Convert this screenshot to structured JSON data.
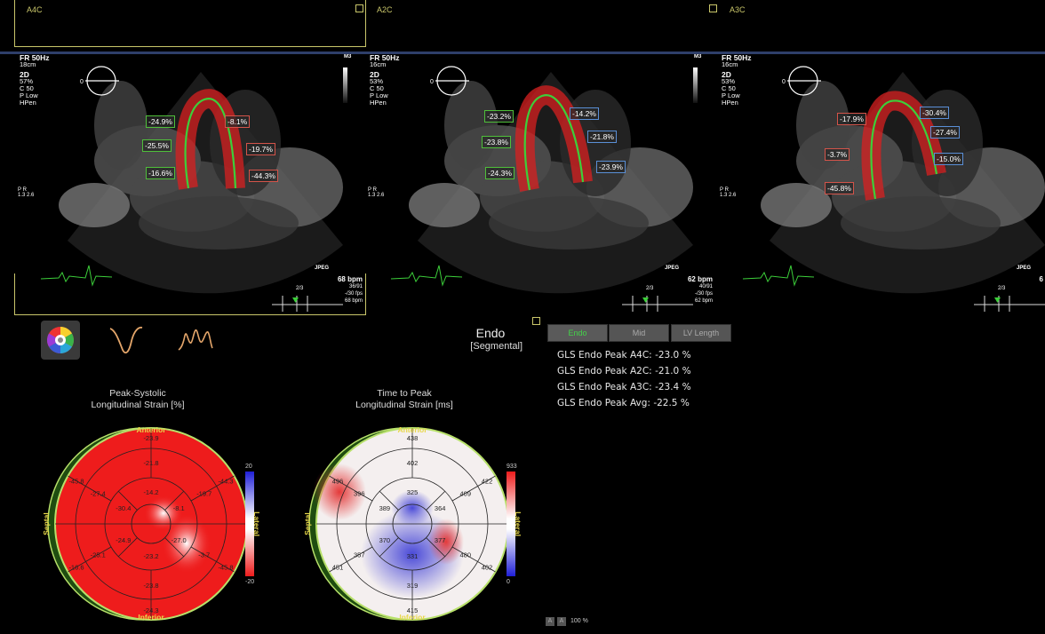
{
  "views": [
    {
      "title": "A4C",
      "fr": "FR 50Hz",
      "depth": "18cm",
      "mode": "2D",
      "params": [
        "57%",
        "C 50",
        "P Low",
        "HPen"
      ],
      "bpm": "68 bpm",
      "frames": "36/91",
      "fps": "-/30 fps",
      "bpm2": "68 bpm",
      "cycle": "2/3",
      "segments": [
        {
          "label": "-24.9%",
          "c": "g"
        },
        {
          "label": "-25.5%",
          "c": "g"
        },
        {
          "label": "-16.6%",
          "c": "g"
        },
        {
          "label": "-8.1%",
          "c": "r"
        },
        {
          "label": "-19.7%",
          "c": "r"
        },
        {
          "label": "-44.3%",
          "c": "r"
        }
      ]
    },
    {
      "title": "A2C",
      "fr": "FR 50Hz",
      "depth": "16cm",
      "mode": "2D",
      "params": [
        "53%",
        "C 50",
        "P Low",
        "HPen"
      ],
      "bpm": "62 bpm",
      "frames": "40/91",
      "fps": "-/30 fps",
      "bpm2": "62 bpm",
      "cycle": "2/3",
      "segments": [
        {
          "label": "-23.2%",
          "c": "g"
        },
        {
          "label": "-23.8%",
          "c": "g"
        },
        {
          "label": "-24.3%",
          "c": "g"
        },
        {
          "label": "-14.2%",
          "c": "b"
        },
        {
          "label": "-21.8%",
          "c": "b"
        },
        {
          "label": "-23.9%",
          "c": "b"
        }
      ]
    },
    {
      "title": "A3C",
      "fr": "FR 50Hz",
      "depth": "16cm",
      "mode": "2D",
      "params": [
        "53%",
        "C 50",
        "P Low",
        "HPen"
      ],
      "bpm": "6",
      "frames": "",
      "fps": "",
      "bpm2": "",
      "cycle": "2/3",
      "segments": [
        {
          "label": "-17.9%",
          "c": "r"
        },
        {
          "label": "-3.7%",
          "c": "r"
        },
        {
          "label": "-45.8%",
          "c": "r"
        },
        {
          "label": "-30.4%",
          "c": "b"
        },
        {
          "label": "-27.4%",
          "c": "b"
        },
        {
          "label": "-15.0%",
          "c": "b"
        }
      ]
    }
  ],
  "m3_label": "M3",
  "jpeg_label": "JPEG",
  "probe": {
    "p": "P",
    "r": "R",
    "zero": "0",
    "left": "1.3",
    "right": "2.6"
  },
  "mode_center": {
    "title": "Endo",
    "subtitle": "[Segmental]"
  },
  "tabs": [
    {
      "label": "Endo",
      "active": true
    },
    {
      "label": "Mid",
      "active": false
    },
    {
      "label": "LV Length",
      "active": false
    }
  ],
  "gls": [
    {
      "label": "GLS Endo Peak A4C:",
      "value": "-23.0 %"
    },
    {
      "label": "GLS Endo Peak A2C:",
      "value": "-21.0 %"
    },
    {
      "label": "GLS Endo Peak A3C:",
      "value": "-23.4 %"
    },
    {
      "label": "GLS Endo Peak Avg:",
      "value": "-22.5 %"
    }
  ],
  "bullseye1": {
    "title_line1": "Peak-Systolic",
    "title_line2": "Longitudinal Strain [%]",
    "anterior": "Anterior",
    "inferior": "Inferior",
    "septal": "Septal",
    "lateral": "Lateral",
    "scale_top": "20",
    "scale_bottom": "-20",
    "values": {
      "s1": "-23.9",
      "s2": "-44.3",
      "s3": "-45.8",
      "s4": "-24.3",
      "s5": "-16.6",
      "s6": "-45.8",
      "m1": "-21.8",
      "m2": "-19.7",
      "m3": "-3.7",
      "m4": "-23.8",
      "m5": "-25.1",
      "m6": "-27.4",
      "a1": "-14.2",
      "a2": "-8.1",
      "a3": "-27.0",
      "a4": "-23.2",
      "a5": "-24.9",
      "a6": "-30.4"
    }
  },
  "bullseye2": {
    "title_line1": "Time to Peak",
    "title_line2": "Longitudinal Strain [ms]",
    "anterior": "Anterior",
    "inferior": "Inferior",
    "septal": "Septal",
    "lateral": "Lateral",
    "scale_top": "933",
    "scale_bottom": "0",
    "values": {
      "s1": "438",
      "s2": "422",
      "s3": "402",
      "s4": "415",
      "s5": "451",
      "s6": "496",
      "m1": "402",
      "m2": "409",
      "m3": "480",
      "m4": "319",
      "m5": "357",
      "m6": "396",
      "a1": "325",
      "a2": "364",
      "a3": "377",
      "a4": "331",
      "a5": "370",
      "a6": "389"
    }
  },
  "zoom": "100 %",
  "colors": {
    "accent": "#c9c66a",
    "trace": "#3ccf3a",
    "strain_red": "#ee1c1c",
    "header_bar": "#2e3f6a"
  }
}
